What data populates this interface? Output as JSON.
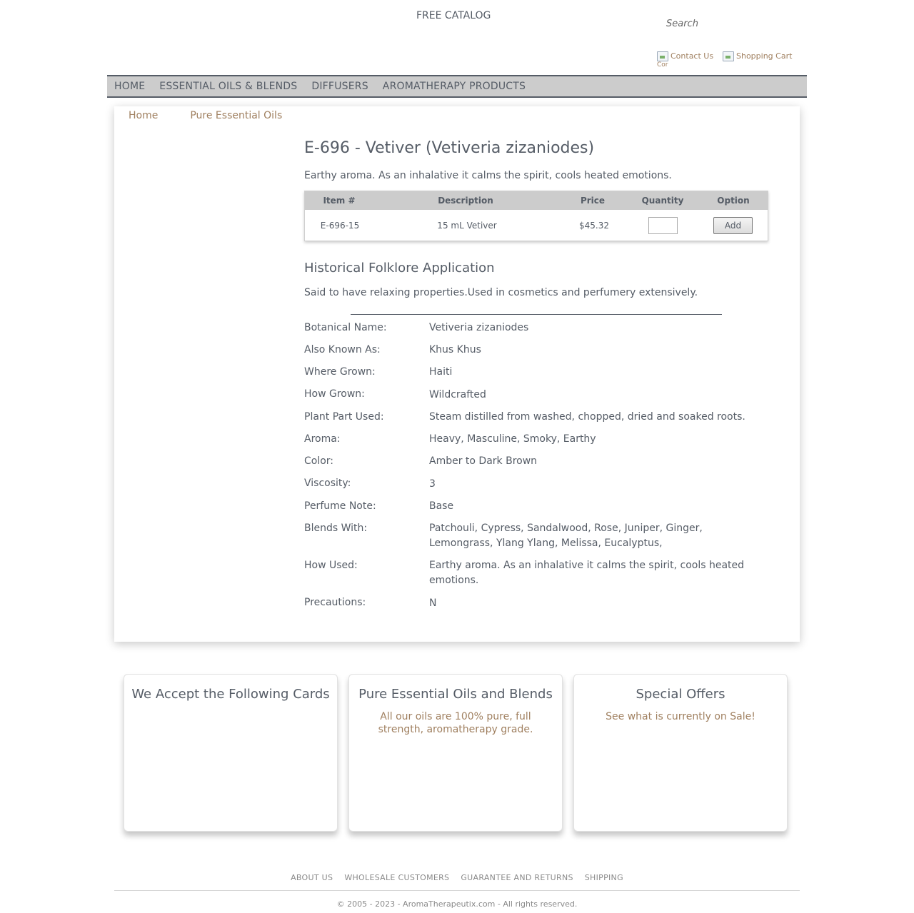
{
  "header": {
    "free_catalog": "FREE CATALOG",
    "search_placeholder": "Search",
    "contact_us": "Contact Us",
    "contact_img_alt": "Cor",
    "shopping_cart": "Shopping Cart"
  },
  "nav": {
    "items": [
      "HOME",
      "ESSENTIAL OILS & BLENDS",
      "DIFFUSERS",
      "AROMATHERAPY PRODUCTS"
    ]
  },
  "breadcrumb": {
    "home": "Home",
    "category": "Pure Essential Oils"
  },
  "product": {
    "title": "E-696 - Vetiver (Vetiveria zizaniodes)",
    "summary": "Earthy aroma. As an inhalative it calms the spirit, cools heated emotions."
  },
  "order_table": {
    "headers": {
      "item": "Item #",
      "description": "Description",
      "price": "Price",
      "quantity": "Quantity",
      "option": "Option"
    },
    "rows": [
      {
        "item": "E-696-15",
        "description": "15 mL Vetiver",
        "price": "$45.32",
        "quantity": "",
        "action": "Add"
      }
    ]
  },
  "folklore": {
    "heading": "Historical Folklore Application",
    "text": "Said to have relaxing properties.Used in cosmetics and perfumery extensively."
  },
  "properties": [
    {
      "label": "Botanical Name:",
      "value": "Vetiveria zizaniodes"
    },
    {
      "label": "Also Known As:",
      "value": "Khus Khus"
    },
    {
      "label": "Where Grown:",
      "value": "Haiti"
    },
    {
      "label": "How Grown:",
      "value": "Wildcrafted"
    },
    {
      "label": "Plant Part Used:",
      "value": "Steam distilled from washed, chopped, dried and soaked roots."
    },
    {
      "label": "Aroma:",
      "value": "Heavy, Masculine, Smoky, Earthy"
    },
    {
      "label": "Color:",
      "value": "Amber to Dark Brown"
    },
    {
      "label": "Viscosity:",
      "value": "3"
    },
    {
      "label": "Perfume Note:",
      "value": "Base"
    },
    {
      "label": "Blends With:",
      "value": "Patchouli, Cypress, Sandalwood, Rose, Juniper, Ginger, Lemongrass, Ylang Ylang, Melissa, Eucalyptus,"
    },
    {
      "label": "How Used:",
      "value": "Earthy aroma. As an inhalative it calms the spirit, cools heated emotions."
    },
    {
      "label": "Precautions:",
      "value": "N"
    }
  ],
  "promos": [
    {
      "title": "We Accept the Following Cards",
      "text": ""
    },
    {
      "title": "Pure Essential Oils and Blends",
      "text": "All our oils are 100% pure, full strength, aromatherapy grade."
    },
    {
      "title": "Special Offers",
      "text": "See what is currently on Sale!"
    }
  ],
  "footer": {
    "links": [
      "ABOUT US",
      "WHOLESALE CUSTOMERS",
      "GUARANTEE AND RETURNS",
      "SHIPPING"
    ],
    "copyright": "© 2005 - 2023 - AromaTherapeutix.com - All rights reserved."
  },
  "colors": {
    "text": "#555c66",
    "link_accent": "#a08060",
    "nav_bg": "#cccccc",
    "footer_text": "#8a8a8a"
  }
}
